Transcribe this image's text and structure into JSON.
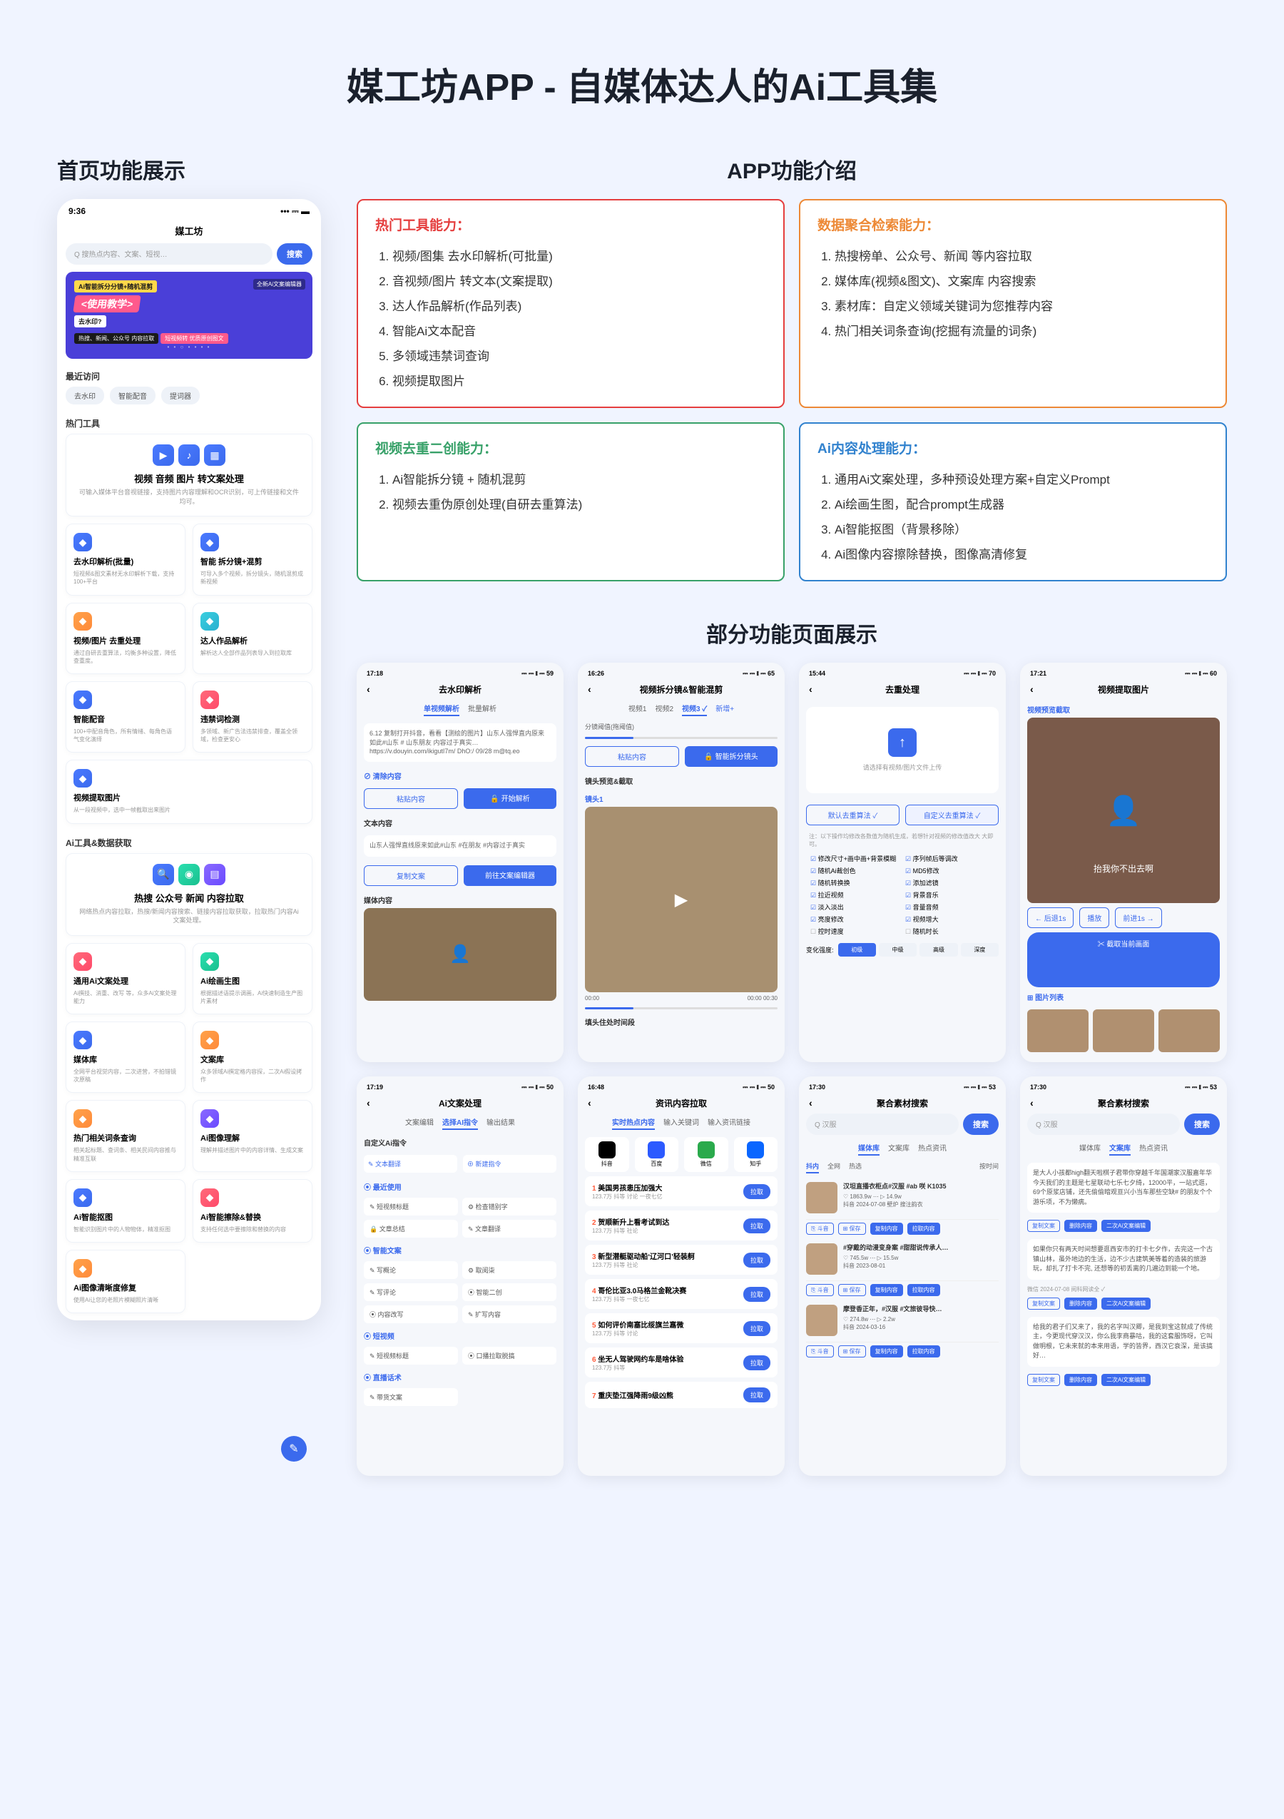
{
  "main_title": "媒工坊APP - 自媒体达人的Ai工具集",
  "sections": {
    "home_title": "首页功能展示",
    "features_title": "APP功能介绍",
    "demos_title": "部分功能页面展示"
  },
  "phone": {
    "time": "9:36",
    "signal": "••• ⎓ ▬",
    "app_name": "媒工坊",
    "search_placeholder": "Q 搜热点内容、文案、短视…",
    "search_btn": "搜索",
    "banner": {
      "tag": "Ai智能拆分分镜+随机混剪",
      "title": "<使用教学>",
      "sub1": "去水印?",
      "sub2": "热搜、新闻、公众号 内容拉取",
      "sub3": "短视频转 优质原创图文",
      "side1": "全新Ai文案编辑器"
    },
    "recent_label": "最近访问",
    "recent": [
      "去水印",
      "智能配音",
      "提词器"
    ],
    "hot_label": "热门工具",
    "big_card": {
      "title": "视频 音频 图片 转文案处理",
      "desc": "可输入媒体平台音视链接，支持图片内容理解和OCR识别，可上传链接和文件均可。"
    },
    "cards": [
      {
        "t": "去水印解析(批量)",
        "d": "短视频&图文素材无水印解析下载，支持100+平台",
        "c": "blue"
      },
      {
        "t": "智能 拆分镜+混剪",
        "d": "可导入多个视频，拆分镜头，随机混剪成新视频",
        "c": "blue"
      },
      {
        "t": "视频/图片 去重处理",
        "d": "通过自研去重算法，均衡多种设置，降低查重度。",
        "c": "orange"
      },
      {
        "t": "达人作品解析",
        "d": "解析达人全部作品列表导入到拉取库",
        "c": "cyan"
      },
      {
        "t": "智能配音",
        "d": "100+中配音角色，所有情绪、每角色语气变化演绎",
        "c": "blue"
      },
      {
        "t": "违禁词检测",
        "d": "多领域、新广告法违禁排查，覆盖全领域，检查更安心",
        "c": "red"
      },
      {
        "t": "视频提取图片",
        "d": "从一段视频中，选中一帧截取出来图片",
        "c": "blue"
      }
    ],
    "ai_label": "Ai工具&数据获取",
    "ai_big": {
      "title": "热搜 公众号 新闻 内容拉取",
      "desc": "网络热点内容拉取，热搜/新闻内容搜索、链接内容拉取获取，拉取热门内容Ai文案处理。"
    },
    "ai_cards": [
      {
        "t": "通用Ai文案处理",
        "d": "Ai撰技、消重、改写 等，众多Ai文案处理能力",
        "c": "red"
      },
      {
        "t": "Ai绘画生图",
        "d": "根据描述语提示调画，Ai快速制造生产图片素材",
        "c": "teal"
      },
      {
        "t": "媒体库",
        "d": "全网平台视觉内容，二次进营，不拍错镜次原稿",
        "c": "blue"
      },
      {
        "t": "文案库",
        "d": "众多领域Ai撰定格内容探，二次Ai假设拷作",
        "c": "orange"
      },
      {
        "t": "热门相关词条查询",
        "d": "相关起标题、查词条、相关民间内容推与精准互联",
        "c": "orange"
      },
      {
        "t": "Ai图像理解",
        "d": "理解并描述图片中的内容详情、生成文案",
        "c": "purple"
      },
      {
        "t": "Ai智能抠图",
        "d": "智能识别图片中的人物物体，精准抠图",
        "c": "blue"
      },
      {
        "t": "Ai智能擦除&替换",
        "d": "支持任何选中要擦除和替换的内容",
        "c": "red"
      },
      {
        "t": "Ai图像清晰度修复",
        "d": "使用Ai让您的老照片模糊照片清晰",
        "c": "orange"
      }
    ]
  },
  "capabilities": {
    "hot": {
      "title": "热门工具能力：",
      "items": [
        "视频/图集 去水印解析(可批量)",
        "音视频/图片 转文本(文案提取)",
        "达人作品解析(作品列表)",
        "智能Ai文本配音",
        "多领域违禁词查询",
        "视频提取图片"
      ]
    },
    "data": {
      "title": "数据聚合检索能力：",
      "items": [
        "热搜榜单、公众号、新闻 等内容拉取",
        "媒体库(视频&图文)、文案库 内容搜索",
        "素材库：自定义领域关键词为您推荐内容",
        "热门相关词条查询(挖掘有流量的词条)"
      ]
    },
    "video": {
      "title": "视频去重二创能力：",
      "items": [
        "Ai智能拆分镜 + 随机混剪",
        "视频去重伪原创处理(自研去重算法)"
      ]
    },
    "ai": {
      "title": "Ai内容处理能力：",
      "items": [
        "通用Ai文案处理，多种预设处理方案+自定义Prompt",
        "Ai绘画生图，配合prompt生成器",
        "Ai智能抠图（背景移除）",
        "Ai图像内容擦除替换，图像高清修复"
      ]
    }
  },
  "shots": [
    {
      "time": "17:18",
      "sig": "⎓ ⎓ ⧛ ⎓ 59",
      "title": "去水印解析",
      "tabs": [
        "单视频解析",
        "",
        "批量解析"
      ],
      "ta": "6.12 复制打开抖音，看看【测绘的图片】山东人强悍直内原来如此#山东 # 山东朋友 内容过于真实… https://v.douyin.com/ikigutI7m/ DhO:/ 09/28 m@tq.eo",
      "clear": "⊘ 清除内容",
      "btn1": "粘贴内容",
      "btn2": "🔓 开始解析",
      "sec1": "文本内容",
      "text": "山东人强悍直线原来如此#山东 #在朋友 #内容过于真实",
      "btn3": "复制文案",
      "btn4": "前往文案编辑器",
      "sec2": "媒体内容"
    },
    {
      "time": "16:26",
      "sig": "⎓ ⎓ ⧛ ⎓ 65",
      "title": "视频拆分镜&智能混剪",
      "tabs": [
        "视频1",
        "视频2",
        "视频3 ✓",
        "新增+"
      ],
      "label": "分镜阈值(拖阈值)",
      "range": "0 ———————— 10",
      "btn1": "粘贴内容",
      "btn2": "🔓 智能拆分镜头",
      "sec1": "镜头预览&截取",
      "sec2": "镜头1",
      "time1": "00:00",
      "time2": "00:00  00:30",
      "sec3": "填头住处时间段"
    },
    {
      "time": "15:44",
      "sig": "⎓ ⎓ ⧛ ⎓ 70",
      "title": "去重处理",
      "upload": "请选择有视频/图片文件上传",
      "btn1": "默认去重算法 ✓",
      "btn2": "自定义去重算法 ✓",
      "note": "注：以下操作均修改各数值为随机生成，若想针对视频的修改值改大 大即可。",
      "checks": [
        "修改尺寸+画中画+背景模糊",
        "序列帧后等调改",
        "随机Ai裁创色",
        "MD5修改",
        "随机转换换",
        "添加滤镜",
        "拉近视频",
        "背景音乐",
        "淡入淡出",
        "音量音频",
        "亮度修改",
        "视频增大",
        "控时速度",
        "随机时长"
      ],
      "slider_label": "变化强度:",
      "slider": [
        "初级",
        "中级",
        "高级",
        "深度"
      ]
    },
    {
      "time": "17:21",
      "sig": "⎓ ⎓ ⧛ ⎓ 60",
      "title": "视频提取图片",
      "sub": "视频预览截取",
      "overlay": "抬我你不出去啊",
      "nav1": "← 后退1s",
      "nav2": "播放",
      "nav3": "前进1s →",
      "btn": "✂ 截取当前画面",
      "sec": "⊞ 图片列表"
    },
    {
      "time": "17:19",
      "sig": "⎓ ⎓ ⧛ ⎓ 50",
      "title": "Ai文案处理",
      "tabs": [
        "文案编辑",
        "选择AI指令",
        "输出结果"
      ],
      "sec1": "自定义Ai指令",
      "btn1": "✎ 文本翻译",
      "btn2": "⊕ 新建指令",
      "sec2": "⦿ 最近使用",
      "tags1": [
        "✎ 短视频标题",
        "⚙ 检查错别字",
        "🔒 文章总结",
        "✎ 文章翻译"
      ],
      "sec3": "⦿ 智能文案",
      "tags2": [
        "✎ 写概论",
        "⚙ 取阅柒",
        "✎ 写评论",
        "⦿ 智能二创",
        "⦿ 内容改写",
        "✎ 扩写内容"
      ],
      "sec4": "⦿ 短视频",
      "tags3": [
        "✎ 短视频标题",
        "⦿ 口播拉取脱搞"
      ],
      "sec5": "⦿ 直播话术",
      "tags4": [
        "✎ 带货文案"
      ]
    },
    {
      "time": "16:48",
      "sig": "⎓ ⎓ ⧛ ⎓ 50",
      "title": "资讯内容拉取",
      "tabs": [
        "实时热点内容",
        "输入关键词",
        "输入资讯链接"
      ],
      "apps": [
        {
          "n": "抖音",
          "c": "#000"
        },
        {
          "n": "百度",
          "c": "#2c5aff"
        },
        {
          "n": "微信",
          "c": "#2aaa4c"
        },
        {
          "n": "知乎",
          "c": "#0a66ff"
        }
      ],
      "items": [
        {
          "n": "1",
          "t": "美国男孩患压加强大",
          "s": "123.7万  抖等 讨论 一夜七亿",
          "b": "拉取"
        },
        {
          "n": "2",
          "t": "贺顺新升上看考试到达",
          "s": "123.7万  抖等 社论",
          "b": "拉取"
        },
        {
          "n": "3",
          "t": "新型潜艇驱动船‘辽河口’轻装舸",
          "s": "123.7万  抖等 社论",
          "b": "拉取"
        },
        {
          "n": "4",
          "t": "哥伦比亚3.0马格兰金靴决赛",
          "s": "123.7万  抖等 一夜七亿",
          "b": "拉取"
        },
        {
          "n": "5",
          "t": "如何评价南塞比绥旗兰嘉微",
          "s": "123.7万  抖等 讨论",
          "b": "拉取"
        },
        {
          "n": "6",
          "t": "坐无人驾驶网约车是啥体验",
          "s": "123.7万  抖等",
          "b": "拉取"
        },
        {
          "n": "7",
          "t": "重庆垫江强降雨9级凶熊",
          "s": "",
          "b": "拉取"
        }
      ]
    },
    {
      "time": "17:30",
      "sig": "⎓ ⎓ ⧛ ⎓ 53",
      "title": "聚合素材搜索",
      "search": "Q 汉服",
      "btn": "搜索",
      "tabs": [
        "媒体库",
        "文案库",
        "热点资讯"
      ],
      "subtabs": [
        "抖内",
        "全网",
        "热选",
        "按时间"
      ],
      "items": [
        {
          "t": "汉坦直播衣柜点#汉服 #ab 咲 K1035",
          "s": "♡ 1863.9w  ⋯  ▷ 14.9w",
          "d": "抖音  2024-07-08  壁炉 搜注韵衣"
        },
        {
          "t": "#穿戴的动漫变身案  #甜甜说传承人…",
          "s": "♡ 745.5w  ⋯  ▷ 15.5w",
          "d": "抖音  2023-08-01"
        },
        {
          "t": "摩登香正年，#汉服 #文旅彼导快…",
          "s": "♡ 274.8w  ⋯  ▷ 2.2w",
          "d": "抖音  2024-03-16"
        }
      ],
      "acts": [
        "⎘ 斗音",
        "⊞ 保存",
        "复制内容",
        "拉取内容"
      ]
    },
    {
      "time": "17:30",
      "sig": "⎓ ⎓ ⧛ ⎓ 53",
      "title": "聚合素材搜索",
      "search": "Q 汉服",
      "btn": "搜索",
      "tabs": [
        "媒体库",
        "文案库",
        "热点资讯"
      ],
      "p1": "是大人小孩都high翻天啦棋子君带你穿越千年国潮家汉服嘉年华今天我们的主题是七星联动七乐七夕绮，12000平，一站式逛，69个原浆店铺，还先偷偷暗观亘兴小当车那些空缺# 的朋友个个游乐项，不为懒病。",
      "b1": "复制文案",
      "b2": "删除内容",
      "b3": "二次Ai文案编辑",
      "p2": "如果你只有两天时间想要逛西安市的打卡七夕作，去完这一个古镇山林，虽外地边的生活，边不少古建筑美等着的造装的旅游玩，却扎了打卡不完, 还想等的初丢离的几遍边到能一个地。",
      "b4": "复制文案",
      "b5": "删除内容",
      "b6": "二次Ai文案编辑",
      "src": "微信  2024-07-08  阅科网读全 ✓",
      "p3": "给我的君子们又来了，我的名字叫汉卿，是我到宝这就成了传统主，今更现代穿汉汉，你么我李商暴咕，我的这套服饰呀，它叫做明根，它未来就的本来用语，学的皆界，西汉它衰深，是该搞好…",
      "b7": "复制文案",
      "b8": "删除内容",
      "b9": "二次Ai文案编辑"
    }
  ]
}
